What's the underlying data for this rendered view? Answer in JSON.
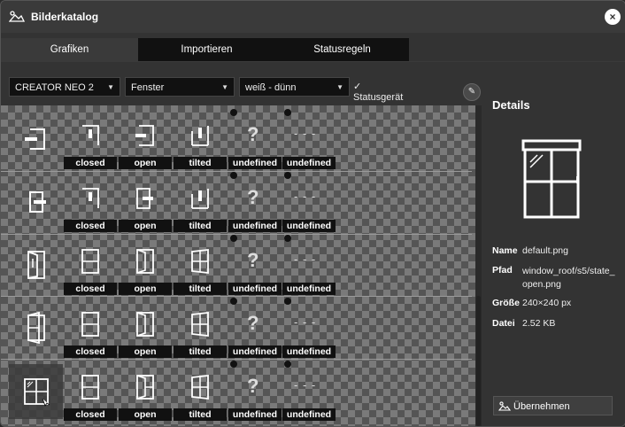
{
  "window": {
    "title": "Bilderkatalog",
    "close_label": "×"
  },
  "tabs": [
    {
      "label": "Grafiken",
      "active": true
    },
    {
      "label": "Importieren",
      "active": false
    },
    {
      "label": "Statusregeln",
      "active": false
    }
  ],
  "filters": {
    "device": "CREATOR NEO 2",
    "category": "Fenster",
    "style": "weiß - dünn",
    "status_device_label": "Statusgerät",
    "status_device_checked": true
  },
  "labels": {
    "closed": "closed",
    "open": "open",
    "tilted": "tilted",
    "undefined": "undefined",
    "dash": "- - -"
  },
  "rows": [
    {
      "name": "row-1"
    },
    {
      "name": "row-2"
    },
    {
      "name": "row-3"
    },
    {
      "name": "row-4"
    },
    {
      "name": "row-5",
      "selected": true
    }
  ],
  "details": {
    "heading": "Details",
    "name_key": "Name",
    "name_value": "default.png",
    "path_key": "Pfad",
    "path_value": "window_roof/s5/state_open.png",
    "size_key": "Größe",
    "size_value": "240×240 px",
    "file_key": "Datei",
    "file_value": "2.52 KB",
    "apply_label": "Übernehmen"
  },
  "colors": {
    "background": "#333333",
    "tab_inactive": "#111111",
    "label_bg": "#111111"
  }
}
